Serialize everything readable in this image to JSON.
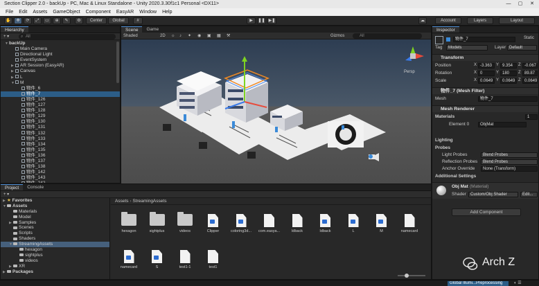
{
  "window": {
    "title": "Section Clipper 2.0 - backUp - PC, Mac & Linux Standalone - Unity 2020.3.30f1c1 Personal <DX11>"
  },
  "menu": [
    "File",
    "Edit",
    "Assets",
    "GameObject",
    "Component",
    "EasyAR",
    "Window",
    "Help"
  ],
  "toolbar": {
    "center": "Center",
    "global": "Global",
    "account": "Account",
    "layers": "Layers",
    "layout": "Layout"
  },
  "hierarchy": {
    "tab": "Hierarchy",
    "search_placeholder": "All",
    "rows": [
      {
        "label": "backUp",
        "depth": 0,
        "arrow": "▼",
        "icon": false
      },
      {
        "label": "Main Camera",
        "depth": 1,
        "arrow": "",
        "icon": true
      },
      {
        "label": "Directional Light",
        "depth": 1,
        "arrow": "",
        "icon": true
      },
      {
        "label": "EventSystem",
        "depth": 1,
        "arrow": "",
        "icon": true
      },
      {
        "label": "AR Session (EasyAR)",
        "depth": 1,
        "arrow": "▶",
        "icon": true
      },
      {
        "label": "Canvas",
        "depth": 1,
        "arrow": "▶",
        "icon": true
      },
      {
        "label": "L",
        "depth": 1,
        "arrow": "▶",
        "icon": true
      },
      {
        "label": "M",
        "depth": 1,
        "arrow": "▼",
        "icon": true
      },
      {
        "label": "物件_6",
        "depth": 2,
        "arrow": "",
        "icon": true
      },
      {
        "label": "物件_7",
        "depth": 2,
        "arrow": "",
        "icon": true,
        "selected": true
      },
      {
        "label": "物件_126",
        "depth": 2,
        "arrow": "",
        "icon": true
      },
      {
        "label": "物件_127",
        "depth": 2,
        "arrow": "",
        "icon": true
      },
      {
        "label": "物件_128",
        "depth": 2,
        "arrow": "",
        "icon": true
      },
      {
        "label": "物件_129",
        "depth": 2,
        "arrow": "",
        "icon": true
      },
      {
        "label": "物件_130",
        "depth": 2,
        "arrow": "",
        "icon": true
      },
      {
        "label": "物件_131",
        "depth": 2,
        "arrow": "",
        "icon": true
      },
      {
        "label": "物件_132",
        "depth": 2,
        "arrow": "",
        "icon": true
      },
      {
        "label": "物件_133",
        "depth": 2,
        "arrow": "",
        "icon": true
      },
      {
        "label": "物件_134",
        "depth": 2,
        "arrow": "",
        "icon": true
      },
      {
        "label": "物件_135",
        "depth": 2,
        "arrow": "",
        "icon": true
      },
      {
        "label": "物件_136",
        "depth": 2,
        "arrow": "",
        "icon": true
      },
      {
        "label": "物件_137",
        "depth": 2,
        "arrow": "",
        "icon": true
      },
      {
        "label": "物件_138",
        "depth": 2,
        "arrow": "",
        "icon": true
      },
      {
        "label": "物件_142",
        "depth": 2,
        "arrow": "",
        "icon": true
      },
      {
        "label": "物件_143",
        "depth": 2,
        "arrow": "",
        "icon": true
      },
      {
        "label": "物件_242",
        "depth": 2,
        "arrow": "",
        "icon": true
      }
    ]
  },
  "scene": {
    "tabs": [
      "Scene",
      "Game"
    ],
    "shading": "Shaded",
    "mode_2d": "2D",
    "gizmos": "Gizmos",
    "search_placeholder": "All",
    "persp": "Persp"
  },
  "inspector": {
    "tab": "Inspector",
    "object_name": "物件_7",
    "static_label": "Static",
    "tag_label": "Tag",
    "tag_value": "Models",
    "layer_label": "Layer",
    "layer_value": "Default",
    "transform": {
      "title": "Transform",
      "position": {
        "label": "Position",
        "x": "-3.363",
        "y": "9.354",
        "z": "-0.067"
      },
      "rotation": {
        "label": "Rotation",
        "x": "0",
        "y": "180",
        "z": "89.87"
      },
      "scale": {
        "label": "Scale",
        "x": "0.0649",
        "y": "0.0649",
        "z": "0.0649"
      }
    },
    "mesh_filter": {
      "title": "物件_7 (Mesh Filter)",
      "mesh_label": "Mesh",
      "mesh_value": "物件_7"
    },
    "mesh_renderer": {
      "title": "Mesh Renderer",
      "materials_label": "Materials",
      "materials_count": "1",
      "element0_label": "Element 0",
      "element0_value": "ObjMat",
      "lighting_label": "Lighting",
      "probes_label": "Probes",
      "light_probes_label": "Light Probes",
      "light_probes_value": "Blend Probes",
      "reflection_probes_label": "Reflection Probes",
      "reflection_probes_value": "Blend Probes",
      "anchor_label": "Anchor Override",
      "anchor_value": "None (Transform)",
      "additional_label": "Additional Settings"
    },
    "material": {
      "name": "Obj Mat",
      "suffix": "(Material)",
      "shader_label": "Shader",
      "shader_value": "Custom/Obj Shader",
      "edit_label": "Edit..."
    },
    "add_component": "Add Component"
  },
  "project": {
    "tabs": [
      "Project",
      "Console"
    ],
    "favorites": "Favorites",
    "tree": [
      {
        "label": "Assets",
        "depth": 0,
        "arrow": "▼",
        "bold": true
      },
      {
        "label": "Materials",
        "depth": 1,
        "arrow": ""
      },
      {
        "label": "Model",
        "depth": 1,
        "arrow": ""
      },
      {
        "label": "Samples",
        "depth": 1,
        "arrow": "▶"
      },
      {
        "label": "Scenes",
        "depth": 1,
        "arrow": ""
      },
      {
        "label": "Scripts",
        "depth": 1,
        "arrow": ""
      },
      {
        "label": "Shaders",
        "depth": 1,
        "arrow": ""
      },
      {
        "label": "StreamingAssets",
        "depth": 1,
        "arrow": "▼",
        "selected": true
      },
      {
        "label": "hexagon",
        "depth": 2,
        "arrow": ""
      },
      {
        "label": "sightplus",
        "depth": 2,
        "arrow": ""
      },
      {
        "label": "videos",
        "depth": 2,
        "arrow": ""
      },
      {
        "label": "XR",
        "depth": 1,
        "arrow": "▶"
      },
      {
        "label": "Packages",
        "depth": 0,
        "arrow": "▶",
        "bold": true
      }
    ],
    "breadcrumb": [
      "Assets",
      "StreamingAssets"
    ],
    "assets_row1": [
      {
        "label": "hexagon",
        "kind": "folder"
      },
      {
        "label": "sightplus",
        "kind": "folder"
      },
      {
        "label": "videos",
        "kind": "folder"
      },
      {
        "label": "Clipper",
        "kind": "cs"
      },
      {
        "label": "coloring3d...",
        "kind": "cs"
      },
      {
        "label": "com.easya...",
        "kind": "doc"
      },
      {
        "label": "ldback",
        "kind": "doc"
      },
      {
        "label": "ldback",
        "kind": "cs"
      },
      {
        "label": "L",
        "kind": "cs"
      },
      {
        "label": "M",
        "kind": "cs"
      },
      {
        "label": "namecard",
        "kind": "doc"
      }
    ],
    "assets_row2": [
      {
        "label": "namecard",
        "kind": "cs"
      },
      {
        "label": "S",
        "kind": "cs"
      },
      {
        "label": "test1-1",
        "kind": "doc"
      },
      {
        "label": "test1",
        "kind": "doc"
      }
    ]
  },
  "status": {
    "progress_label": "Global Illumi...Preprocessing"
  },
  "watermark": {
    "text": "Arch Z"
  }
}
